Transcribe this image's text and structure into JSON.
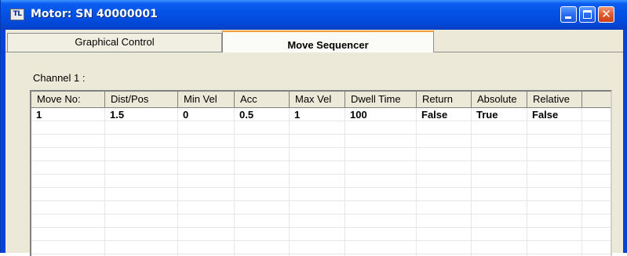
{
  "window": {
    "app_icon_text": "TL",
    "title": "Motor: SN 40000001",
    "close_glyph": "✕"
  },
  "tabs": [
    {
      "label": "Graphical Control",
      "active": false
    },
    {
      "label": "Move Sequencer",
      "active": true
    }
  ],
  "panel": {
    "channel_label": "Channel 1 :"
  },
  "table": {
    "columns": [
      "Move No:",
      "Dist/Pos",
      "Min Vel",
      "Acc",
      "Max Vel",
      "Dwell Time",
      "Return",
      "Absolute",
      "Relative",
      ""
    ],
    "rows": [
      [
        "1",
        "1.5",
        "0",
        "0.5",
        "1",
        "100",
        "False",
        "True",
        "False",
        ""
      ]
    ]
  },
  "colors": {
    "titlebar": "#0452e6",
    "client_bg": "#ece9d8",
    "active_tab_accent": "#f3a03c",
    "close_button": "#e25a2e"
  },
  "icons": {
    "app": "tl-app-icon",
    "minimize": "minimize-icon",
    "maximize": "maximize-icon",
    "close": "close-icon"
  }
}
